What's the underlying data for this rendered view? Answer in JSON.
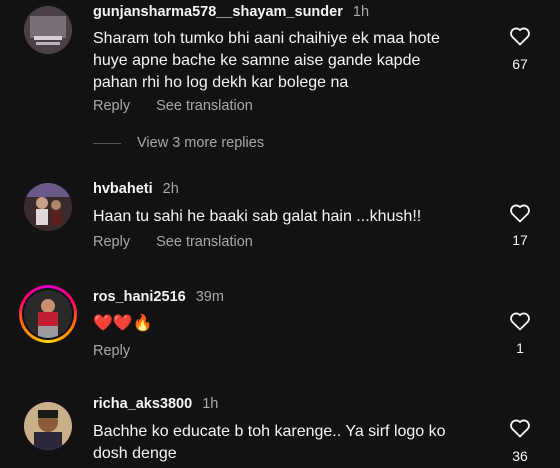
{
  "comments": [
    {
      "username": "gunjansharma578__shayam_sunder",
      "time": "1h",
      "text": "Sharam toh tumko bhi aani chaihiye ek maa hote huye apne bache ke samne aise gande kapde pahan rhi ho  log dekh kar bolege na",
      "reply": "Reply",
      "see_translation": "See translation",
      "likes": "67",
      "view_replies": "View 3 more replies"
    },
    {
      "username": "hvbaheti",
      "time": "2h",
      "text": "Haan tu sahi he baaki sab galat hain ...khush!!",
      "reply": "Reply",
      "see_translation": "See translation",
      "likes": "17"
    },
    {
      "username": "ros_hani2516",
      "time": "39m",
      "text": "❤️❤️🔥",
      "reply": "Reply",
      "likes": "1"
    },
    {
      "username": "richa_aks3800",
      "time": "1h",
      "text": "Bachhe ko educate b toh karenge.. Ya sirf logo ko dosh denge",
      "likes": "36"
    }
  ],
  "colors": {
    "background": "#121212",
    "primary_text": "#f5f5f5",
    "secondary_text": "#a8a8a8"
  },
  "icons": {
    "like": "heart-outline-icon"
  }
}
